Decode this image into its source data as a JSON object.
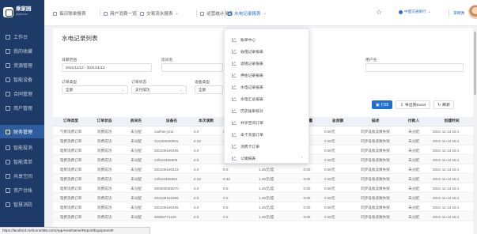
{
  "app": {
    "logo_name": "乘家园",
    "logo_sub": "jiejiayuan"
  },
  "sidebar": {
    "items": [
      {
        "label": "工作台"
      },
      {
        "label": "我的收藏"
      },
      {
        "label": "资源管理"
      },
      {
        "label": "智能设备"
      },
      {
        "label": "合同管理"
      },
      {
        "label": "用户管理"
      },
      {
        "label": "财务管理",
        "active": true
      },
      {
        "label": "智能投消"
      },
      {
        "label": "智能清单"
      },
      {
        "label": "共享空间"
      },
      {
        "label": "资产台账"
      },
      {
        "label": "智慧消防"
      }
    ]
  },
  "header": {
    "tabs": [
      {
        "label": "每日账单报表"
      },
      {
        "label": "用户消费一览"
      },
      {
        "label": "交易流水报表"
      },
      {
        "label": "运营统计报表"
      },
      {
        "label": "水电记录报表",
        "active": true
      }
    ],
    "tenant": "中国交通银行",
    "user": "李啊秀"
  },
  "page": {
    "title": "水电记录列表"
  },
  "filters": {
    "date_label": "日期范围",
    "date_value": "2021/11/12 - 2021/11/13",
    "room_label": "房间名",
    "user_label": "用户名",
    "order_type_label": "订单类型",
    "order_type_value": "全部",
    "order_status_label": "订单状态",
    "order_status_value": "支付成功",
    "device_type_label": "设备类型",
    "device_type_value": "全部"
  },
  "actions": {
    "print": "打印",
    "export": "导出到Excel",
    "refresh": "刷新"
  },
  "table": {
    "columns": [
      "订单类型",
      "订单状态",
      "房间名",
      "设备名",
      "本次读数",
      "上次读数",
      "单价",
      "使用量",
      "总金额",
      "描述",
      "付款人",
      "创建时间"
    ],
    "rows": [
      [
        "气费消费订单",
        "消费成功",
        "未分配",
        "cashier-j211",
        "0.0",
        "0.0",
        "0",
        "",
        "0.00元",
        "同步设备读数失败",
        "未分配",
        "2021-11-13 18:1"
      ],
      [
        "电费消费订单",
        "消费成功",
        "未分配",
        "211003030001",
        "0.32",
        "",
        "",
        "",
        "0.00元",
        "同步设备读数失败",
        "未分配",
        "2021-11-13 18:1"
      ],
      [
        "电费消费订单",
        "消费成功",
        "未分配",
        "202109160465",
        "0.0",
        "",
        "",
        "",
        "0.00元",
        "同步设备读数失败",
        "未分配",
        "2021-11-13 18:1"
      ],
      [
        "电费消费订单",
        "消费成功",
        "未分配",
        "12f624455005",
        "0.0",
        "",
        "",
        "",
        "0.00元",
        "同步设备读数失败",
        "未分配",
        "2021-11-13 18:1"
      ],
      [
        "电费消费订单",
        "消费成功",
        "未分配",
        "202109160423",
        "0.0",
        "0.0",
        "1.25元/度",
        "0.00",
        "0.00元",
        "同步设备读数失败",
        "未分配",
        "2021-11-13 18:1"
      ],
      [
        "电费消费订单",
        "消费成功",
        "未分配",
        "12f624455001",
        "0.32",
        "0.32",
        "1.25元/度",
        "0.00",
        "0.00元",
        "同步设备读数失败",
        "未分配",
        "2021-11-13 18:1"
      ],
      [
        "电费消费订单",
        "消费成功",
        "未分配",
        "000000085070",
        "0.0",
        "0.0",
        "1.25元/度",
        "0.00",
        "0.00元",
        "同步设备读数失败",
        "未分配",
        "2021-11-13 18:1"
      ],
      [
        "电费消费订单",
        "消费成功",
        "未分配",
        "202109161696",
        "0.0",
        "0.0",
        "1.25元/度",
        "0.00",
        "0.00元",
        "同步设备读数失败",
        "未分配",
        "2021-11-13 18:1"
      ],
      [
        "电费消费订单",
        "消费成功",
        "未分配",
        "202109160465",
        "0.0",
        "0.0",
        "1.25元/度",
        "0.00",
        "0.00元",
        "同步设备读数失败",
        "未分配",
        "2021-11-13 18:1"
      ],
      [
        "电费消费订单",
        "消费成功",
        "未分配",
        "00805771125",
        "0.0",
        "0.0",
        "1.25元/度",
        "0.00",
        "0.00元",
        "同步设备读数失败",
        "未分配",
        "2021-11-13 18:1"
      ]
    ]
  },
  "dropdown": {
    "items": [
      {
        "label": "账单中心"
      },
      {
        "label": "收租记录报表"
      },
      {
        "label": "退租记录报表"
      },
      {
        "label": "押金记录报表"
      },
      {
        "label": "水电记录报表"
      },
      {
        "label": "水电汇总报表"
      },
      {
        "label": "历史账单核对"
      },
      {
        "label": "共享空间订单"
      },
      {
        "label": "未卡充值订单"
      },
      {
        "label": "消费卡订单"
      },
      {
        "label": "公寓报表",
        "has_sub": true
      }
    ]
  },
  "statusbar": {
    "url": "https://landlord.mehome365.com/AppArea/Name/Report/Equipment#"
  }
}
